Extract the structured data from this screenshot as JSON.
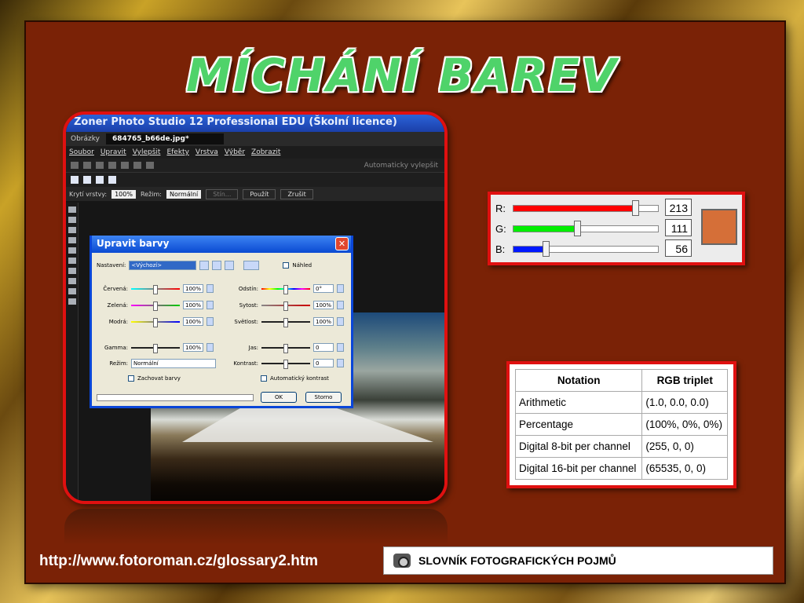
{
  "slide": {
    "title": "MÍCHÁNÍ BAREV",
    "link": "http://www.fotoroman.cz/glossary2.htm",
    "banner": "SLOVNÍK FOTOGRAFICKÝCH POJMŮ"
  },
  "app": {
    "title": "Zoner Photo Studio 12 Professional EDU (Školní licence)",
    "nav_label": "Obrázky",
    "tab": "684765_b66de.jpg*",
    "menu": [
      "Soubor",
      "Upravit",
      "Vylepšit",
      "Efekty",
      "Vrstva",
      "Výběr",
      "Zobrazit"
    ],
    "auto_enhance": "Automaticky vylepšit",
    "options": {
      "opacity_label": "Krytí vrstvy:",
      "opacity": "100%",
      "mode_label": "Režim:",
      "mode": "Normální",
      "shadow": "Stín...",
      "apply": "Použít",
      "cancel": "Zrušit"
    }
  },
  "dialog": {
    "title": "Upravit barvy",
    "preset_label": "Nastavení:",
    "preset": "<Výchozí>",
    "preview": "Náhled",
    "left": [
      {
        "label": "Červená:",
        "value": "100%"
      },
      {
        "label": "Zelená:",
        "value": "100%"
      },
      {
        "label": "Modrá:",
        "value": "100%"
      },
      {
        "label": "Gamma:",
        "value": "100%"
      }
    ],
    "right": [
      {
        "label": "Odstín:",
        "value": "0°"
      },
      {
        "label": "Sytost:",
        "value": "100%"
      },
      {
        "label": "Světlost:",
        "value": "100%"
      },
      {
        "label": "Jas:",
        "value": "0"
      },
      {
        "label": "Kontrast:",
        "value": "0"
      }
    ],
    "mode_label": "Režim:",
    "mode": "Normální",
    "keep_colors": "Zachovat barvy",
    "auto_contrast": "Automatický kontrast",
    "ok": "OK",
    "cancel": "Storno"
  },
  "rgb": {
    "channels": [
      {
        "label": "R:",
        "value": "213",
        "fraction": 0.835,
        "color": "#ff0000"
      },
      {
        "label": "G:",
        "value": "111",
        "fraction": 0.435,
        "color": "#00ee00"
      },
      {
        "label": "B:",
        "value": "56",
        "fraction": 0.22,
        "color": "#0018ff"
      }
    ],
    "swatch": "#d56f38"
  },
  "notation": {
    "headers": [
      "Notation",
      "RGB triplet"
    ],
    "rows": [
      [
        "Arithmetic",
        "(1.0, 0.0, 0.0)"
      ],
      [
        "Percentage",
        "(100%, 0%, 0%)"
      ],
      [
        "Digital 8-bit per channel",
        "(255, 0, 0)"
      ],
      [
        "Digital 16-bit per channel",
        "(65535, 0, 0)"
      ]
    ]
  }
}
